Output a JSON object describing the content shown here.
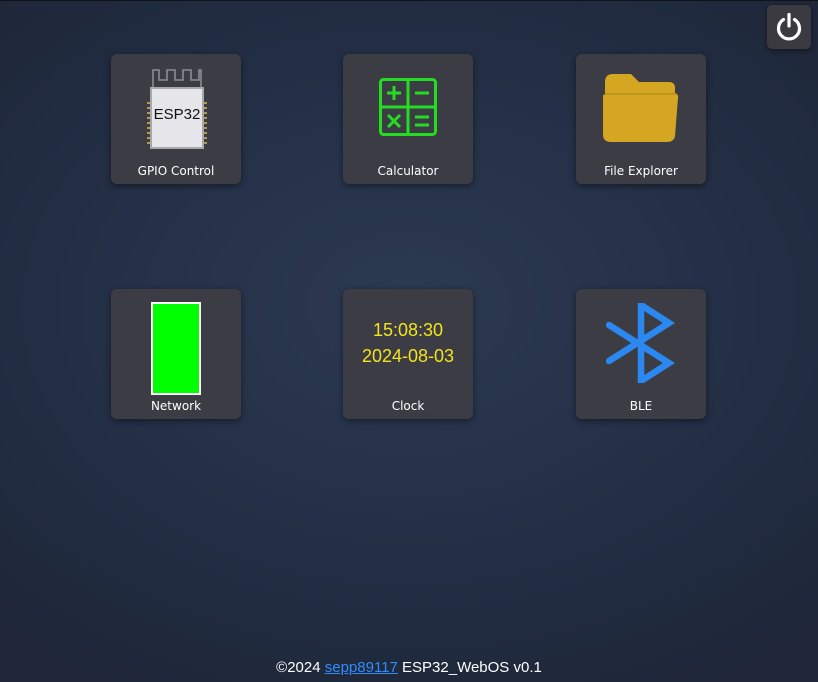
{
  "header": {
    "power_icon": "power-icon"
  },
  "apps": [
    {
      "label": "GPIO Control",
      "icon": "esp32-chip-icon",
      "chip_text": "ESP32"
    },
    {
      "label": "Calculator",
      "icon": "calculator-icon",
      "color": "#22dd22"
    },
    {
      "label": "File Explorer",
      "icon": "folder-icon",
      "color": "#d4a622"
    },
    {
      "label": "Network",
      "icon": "signal-bar-icon",
      "color": "#00ff00"
    },
    {
      "label": "Clock",
      "icon": "clock-display",
      "time": "15:08:30",
      "date": "2024-08-03",
      "color": "#f2e41c"
    },
    {
      "label": "BLE",
      "icon": "bluetooth-icon",
      "color": "#2a88f0"
    }
  ],
  "footer": {
    "copyright": "©2024 ",
    "author": "sepp89117",
    "product": " ESP32_WebOS v0.1"
  },
  "colors": {
    "background": "#243047",
    "tile": "#3c3c44",
    "link": "#2f8cff"
  }
}
